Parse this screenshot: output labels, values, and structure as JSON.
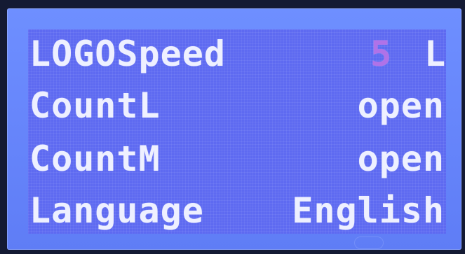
{
  "display": {
    "rows": [
      {
        "label": "LOGOSpeed",
        "value": "5",
        "unit": "L"
      },
      {
        "label": "CountL",
        "value": "open"
      },
      {
        "label": "CountM",
        "value": "open"
      },
      {
        "label": "Language",
        "value": "English"
      }
    ]
  },
  "colors": {
    "background": "#5e6af1",
    "text": "#eef0ff",
    "speed_value": "#b072e8"
  }
}
